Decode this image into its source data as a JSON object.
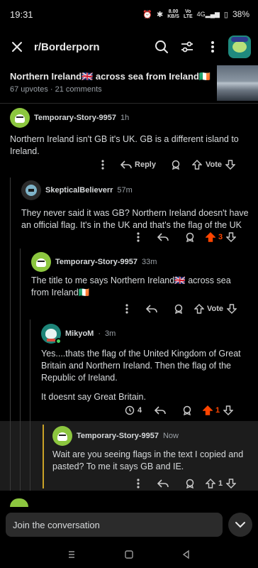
{
  "status": {
    "time": "19:31",
    "speed_val": "8.00",
    "speed_unit": "KB/S",
    "net1": "Vo",
    "net2": "LTE",
    "signal": "4G",
    "battery": "38%"
  },
  "topbar": {
    "title": "r/Borderporn"
  },
  "post": {
    "title": "Northern Ireland🇬🇧 across sea from Ireland🇮🇪",
    "meta": "67 upvotes · 21 comments"
  },
  "comments": [
    {
      "author": "Temporary-Story-9957",
      "time": "1h",
      "body": "Northern Ireland isn't GB it's UK. GB is a different island to Ireland.",
      "reply_label": "Reply",
      "vote_label": "Vote"
    },
    {
      "author": "SkepticalBelieverr",
      "time": "57m",
      "body": "They never said it was GB? Northern Ireland doesn't have an official flag. It's in the UK and that's the flag of the UK",
      "score": "3"
    },
    {
      "author": "Temporary-Story-9957",
      "time": "33m",
      "body": "The title to me says Northern Ireland🇬🇧 across sea from Ireland🇮🇪",
      "vote_label": "Vote"
    },
    {
      "author": "MikyoM",
      "time": "3m",
      "body1": "Yes....thats the flag of the United Kingdom of Great Britain and Northern Ireland. Then the flag of the Republic of Ireland.",
      "body2": "It doesnt say Great Britain.",
      "awards": "4",
      "score": "1"
    },
    {
      "author": "Temporary-Story-9957",
      "time": "Now",
      "body": "Wait are you seeing flags in the text I copied and pasted? To me it says GB and IE.",
      "score": "1"
    }
  ],
  "bottom": {
    "join_label": "Join the conversation"
  },
  "colors": {
    "upvote_active": "#ff4500",
    "online": "#46d160",
    "highlight_bar": "#c9a227"
  }
}
